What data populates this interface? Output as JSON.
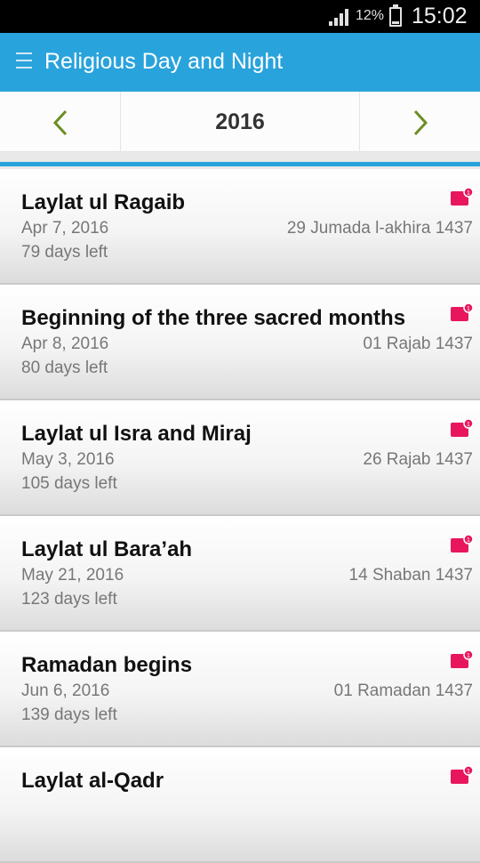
{
  "status_bar": {
    "battery": "12%",
    "time": "15:02"
  },
  "app_bar": {
    "title": "Religious Day and Night"
  },
  "year_nav": {
    "year": "2016"
  },
  "events": [
    {
      "name": "Laylat ul Ragaib",
      "date": "Apr 7, 2016",
      "days_left": "79 days left",
      "hijri": "29 Jumada l-akhira 1437"
    },
    {
      "name": "Beginning of the three sacred months",
      "date": "Apr 8, 2016",
      "days_left": "80 days left",
      "hijri": "01 Rajab 1437"
    },
    {
      "name": "Laylat ul Isra and Miraj",
      "date": "May 3, 2016",
      "days_left": "105 days left",
      "hijri": "26 Rajab 1437"
    },
    {
      "name": "Laylat ul Bara’ah",
      "date": "May 21, 2016",
      "days_left": "123 days left",
      "hijri": "14 Shaban 1437"
    },
    {
      "name": "Ramadan begins",
      "date": "Jun 6, 2016",
      "days_left": "139 days left",
      "hijri": "01 Ramadan 1437"
    },
    {
      "name": "Laylat al-Qadr",
      "date": "",
      "days_left": "",
      "hijri": ""
    }
  ],
  "colors": {
    "accent": "#29a3dc",
    "badge": "#e8175d",
    "nav_arrow": "#6b8e23"
  }
}
